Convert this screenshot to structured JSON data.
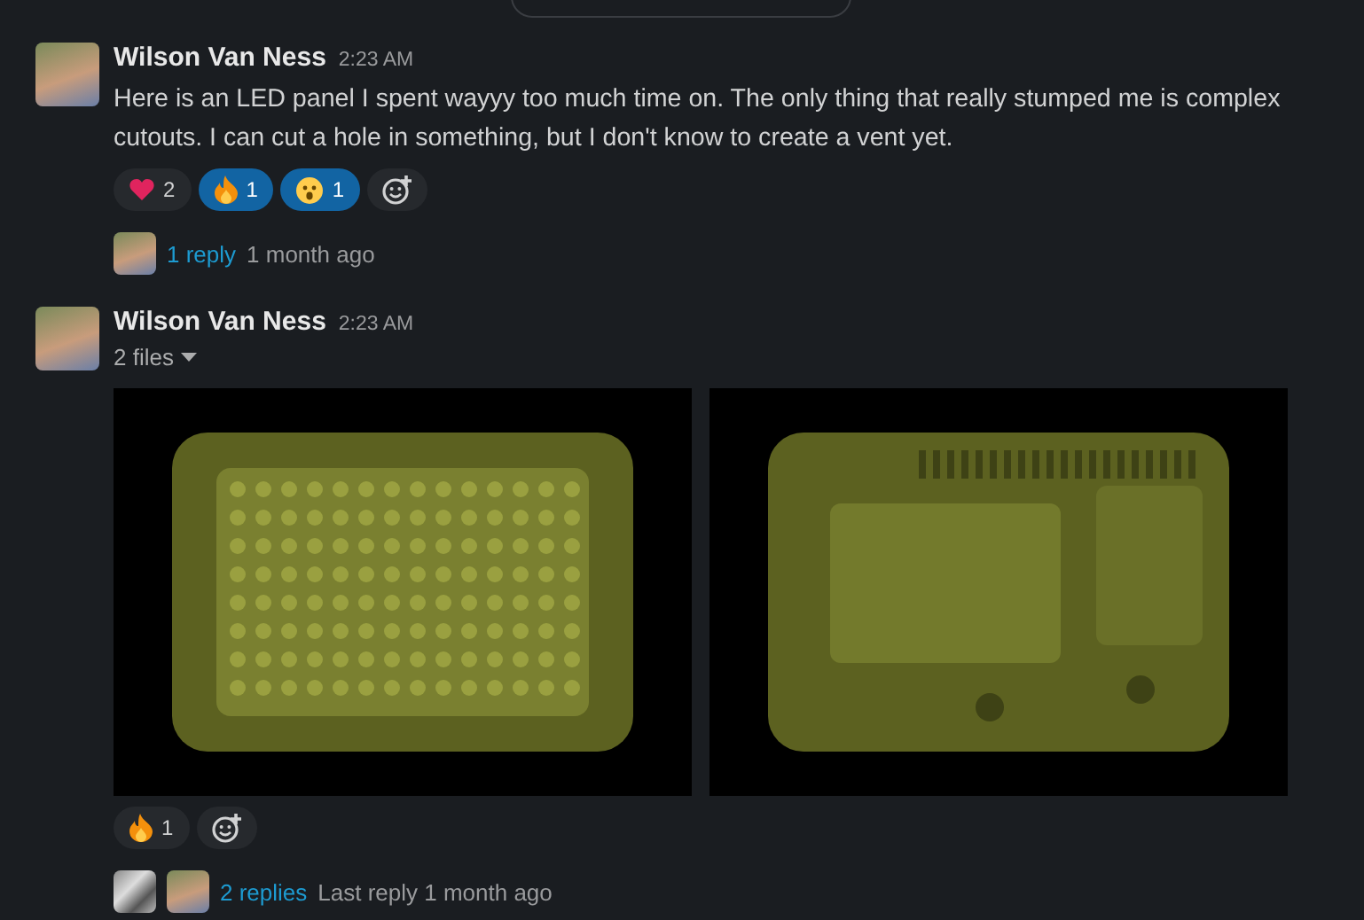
{
  "messages": [
    {
      "author": "Wilson Van Ness",
      "time": "2:23 AM",
      "text": "Here is an LED panel I spent wayyy too much time on. The only thing that really stumped me is complex cutouts. I can cut a hole in something, but I don't know to create a vent yet.",
      "reactions": [
        {
          "kind": "heart",
          "count": "2",
          "selected": false
        },
        {
          "kind": "fire",
          "count": "1",
          "selected": true
        },
        {
          "kind": "surprised",
          "count": "1",
          "selected": true
        }
      ],
      "thread": {
        "avatars": [
          {
            "kind": "portrait"
          }
        ],
        "replies": "1 reply",
        "last": "1 month ago"
      }
    },
    {
      "author": "Wilson Van Ness",
      "time": "2:23 AM",
      "files_label": "2 files",
      "files": [
        {
          "kind": "front"
        },
        {
          "kind": "back"
        }
      ],
      "reactions": [
        {
          "kind": "fire",
          "count": "1",
          "selected": false
        }
      ],
      "thread": {
        "avatars": [
          {
            "kind": "collage"
          },
          {
            "kind": "portrait"
          }
        ],
        "replies": "2 replies",
        "last": "Last reply 1 month ago"
      }
    }
  ]
}
